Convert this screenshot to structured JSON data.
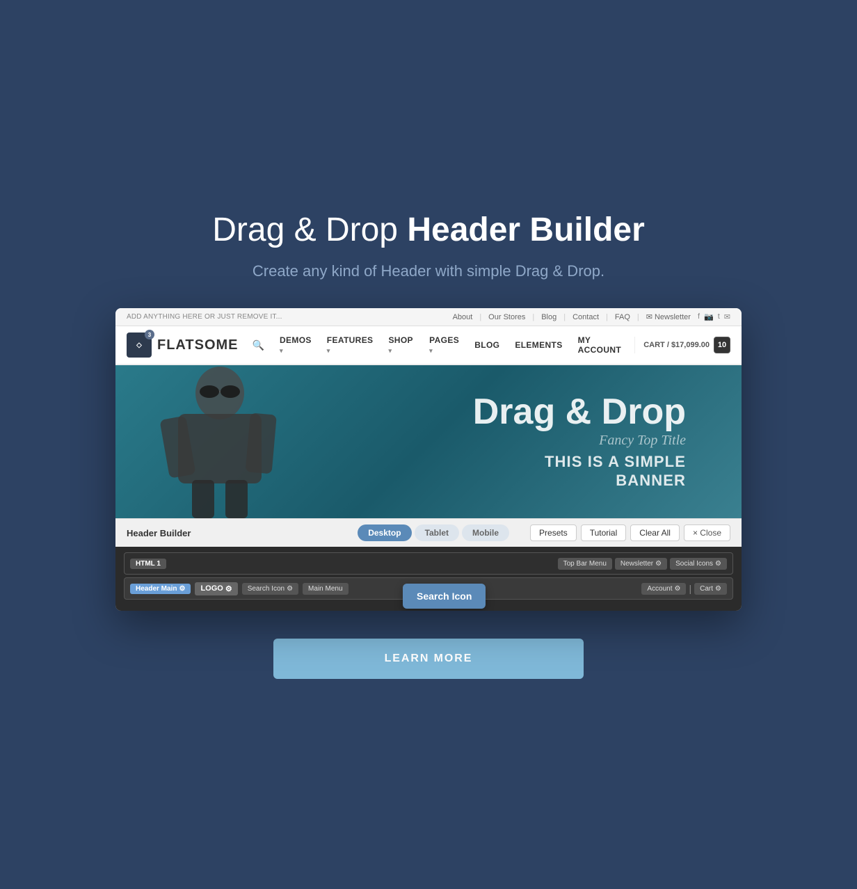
{
  "page": {
    "background_color": "#2d4263"
  },
  "hero": {
    "title_light": "Drag & Drop ",
    "title_bold": "Header Builder",
    "subtitle": "Create any kind of Header with simple Drag & Drop."
  },
  "topbar": {
    "left_text": "ADD ANYTHING HERE OR JUST REMOVE IT...",
    "nav_items": [
      "About",
      "Our Stores",
      "Blog",
      "Contact",
      "FAQ"
    ],
    "newsletter_label": "Newsletter",
    "social": [
      "f",
      "📷",
      "t",
      "✉"
    ]
  },
  "main_nav": {
    "logo_text": "FLATSOME",
    "logo_badge": "3",
    "items": [
      {
        "label": "DEMOS",
        "has_arrow": true
      },
      {
        "label": "FEATURES",
        "has_arrow": true
      },
      {
        "label": "SHOP",
        "has_arrow": true
      },
      {
        "label": "PAGES",
        "has_arrow": true
      },
      {
        "label": "BLOG",
        "has_arrow": false
      },
      {
        "label": "ELEMENTS",
        "has_arrow": false
      },
      {
        "label": "MY ACCOUNT",
        "has_arrow": false
      }
    ],
    "cart_label": "CART / $17,099.00",
    "cart_count": "10"
  },
  "banner": {
    "title": "Drag & Drop",
    "fancy_title": "Fancy Top Title",
    "subtitle": "THIS IS A SIMPLE\nBANNER"
  },
  "builder_bar": {
    "label": "Header Builder",
    "device_tabs": [
      "Desktop",
      "Tablet",
      "Mobile"
    ],
    "active_tab": "Desktop",
    "actions": [
      "Presets",
      "Tutorial",
      "Clear All",
      "× Close"
    ]
  },
  "builder_area": {
    "top_row_label": "HTML 1",
    "top_row_items_right": [
      "Top Bar Menu",
      "Newsletter",
      "Social Icons"
    ],
    "header_main_label": "Header Main",
    "bottom_items": [
      "Search Icon",
      "Main Menu"
    ],
    "bottom_items_right": [
      "Account",
      "|",
      "Cart"
    ],
    "logo_label": "LOGO"
  },
  "tooltip": {
    "label": "Search Icon"
  },
  "cta": {
    "label": "LEARN MORE"
  }
}
